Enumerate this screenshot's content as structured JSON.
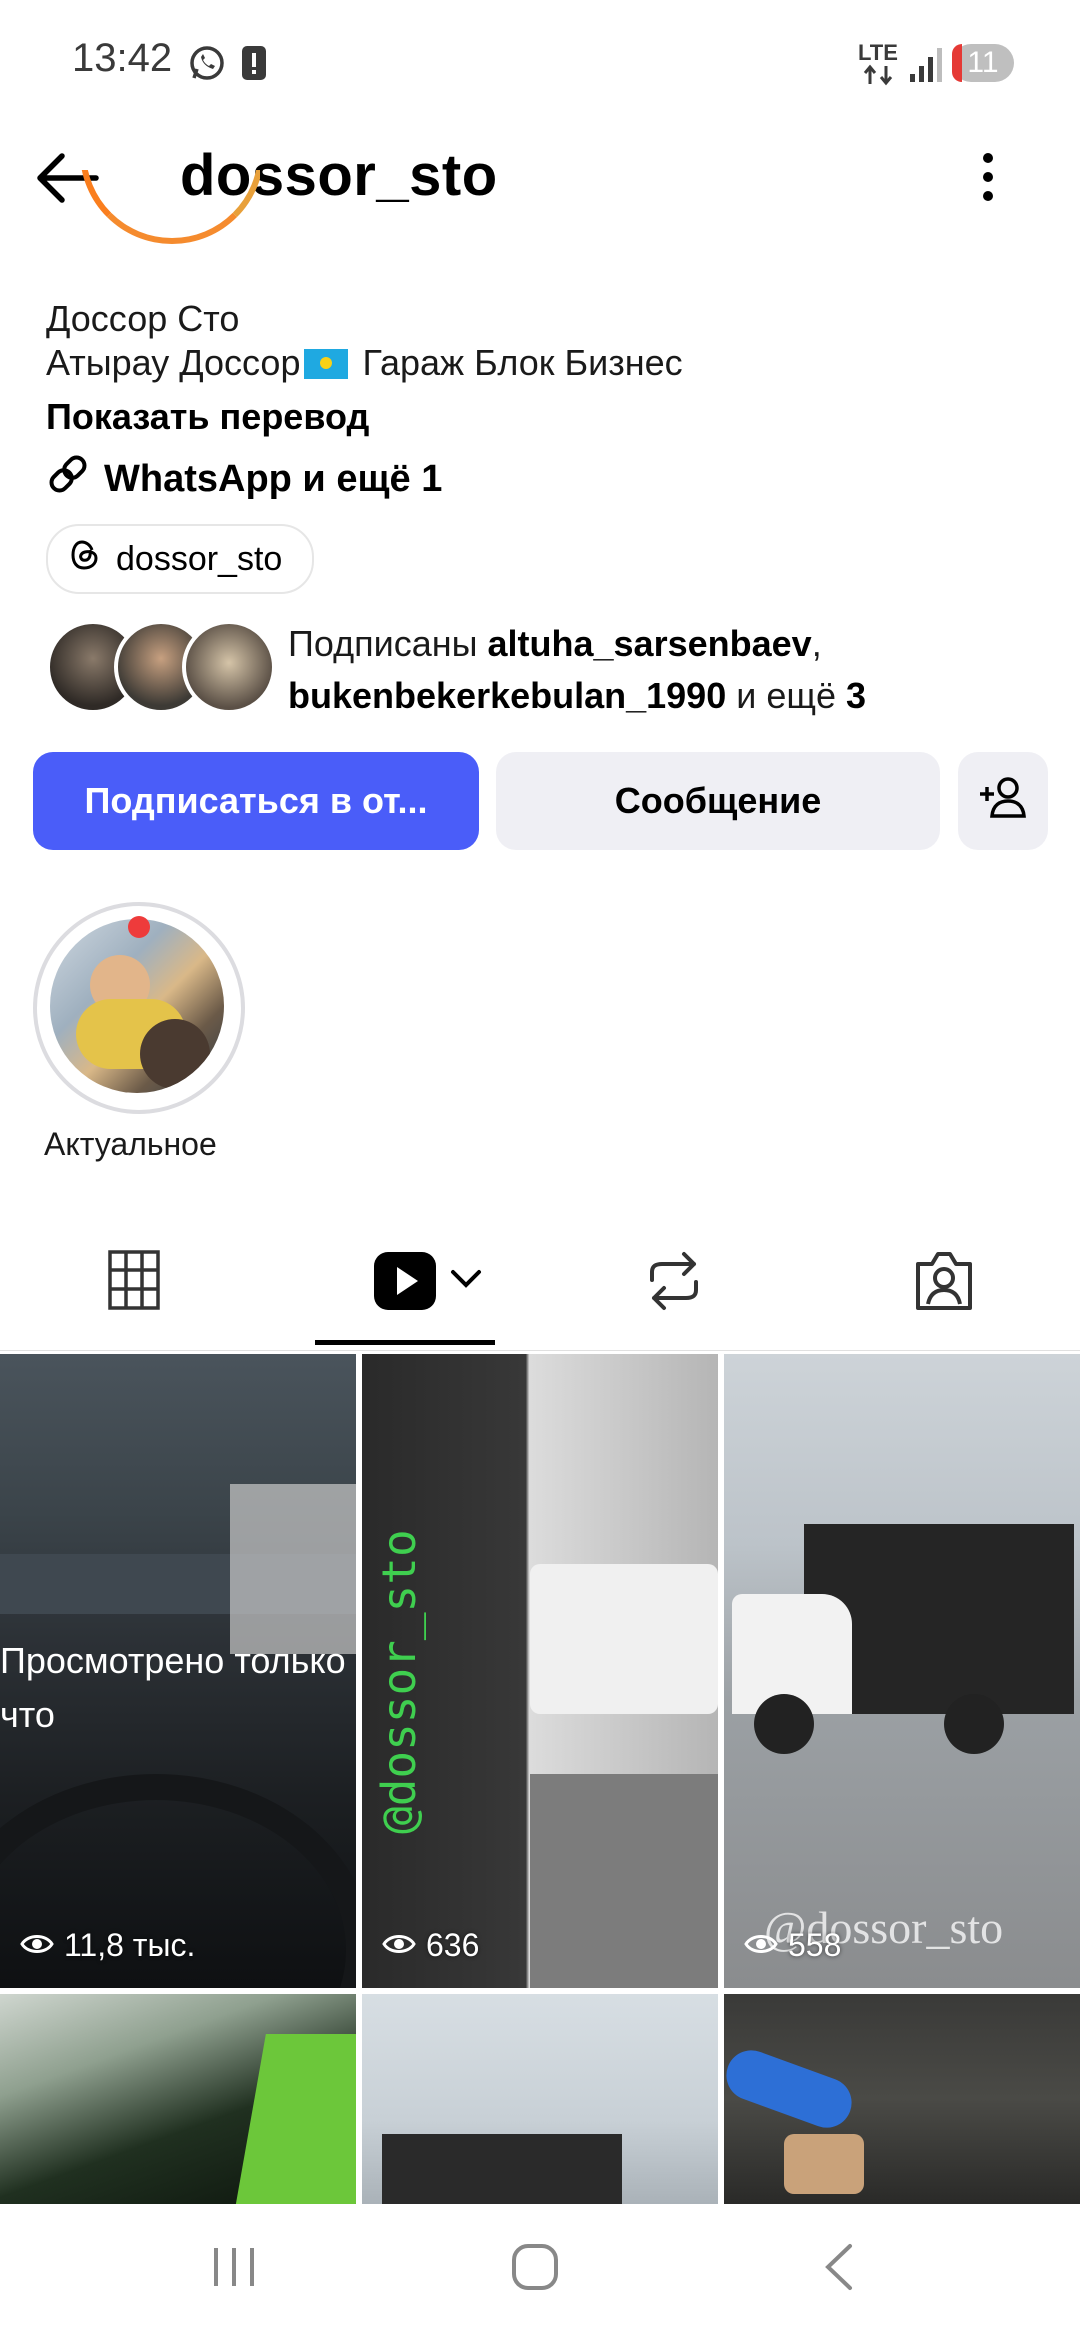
{
  "status_bar": {
    "time": "13:42",
    "network": "LTE",
    "battery": "11"
  },
  "header": {
    "username": "dossor_sto"
  },
  "profile": {
    "name": "Доссор Сто",
    "bio_before_flag": "Атырау Доссор",
    "bio_after_flag": " Гараж Блок Бизнес",
    "translate_label": "Показать перевод",
    "link_text": "WhatsApp и ещё 1",
    "threads_handle": "dossor_sto",
    "followers_prefix": "Подписаны ",
    "follower1": "altuha_sarsenbaev",
    "follower_sep": ",",
    "follower2": "bukenbekerkebulan_1990",
    "followers_middle": " и ещё ",
    "followers_more": "3"
  },
  "actions": {
    "follow_label": "Подписаться в от...",
    "message_label": "Сообщение"
  },
  "highlights": [
    {
      "label": "Актуальное"
    }
  ],
  "tabs": [
    {
      "name": "grid",
      "icon": "grid-icon"
    },
    {
      "name": "reels",
      "icon": "reels-icon",
      "selected": true
    },
    {
      "name": "reposts",
      "icon": "repost-icon"
    },
    {
      "name": "tagged",
      "icon": "tagged-icon"
    }
  ],
  "grid": {
    "seen_label": "Просмотрено только что",
    "views": [
      "11,8 тыс.",
      "636",
      "558"
    ],
    "watermark": "@dossor_sto"
  },
  "colors": {
    "accent": "#4a5df9",
    "button_gray": "#efeff4"
  }
}
